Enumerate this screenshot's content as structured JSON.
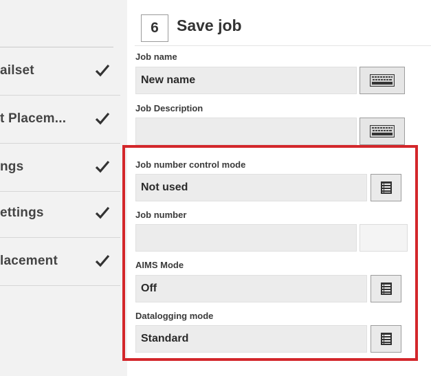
{
  "sidebar": {
    "items": [
      {
        "label": "ailset"
      },
      {
        "label": "t Placem..."
      },
      {
        "label": "ngs"
      },
      {
        "label": "ettings"
      },
      {
        "label": "lacement"
      }
    ]
  },
  "header": {
    "step_number": "6",
    "title": "Save job"
  },
  "form": {
    "job_name": {
      "label": "Job name",
      "value": "New name"
    },
    "job_description": {
      "label": "Job Description",
      "value": ""
    },
    "job_number_control_mode": {
      "label": "Job number control mode",
      "value": "Not used"
    },
    "job_number": {
      "label": "Job number",
      "value": ""
    },
    "aims_mode": {
      "label": "AIMS Mode",
      "value": "Off"
    },
    "datalogging_mode": {
      "label": "Datalogging mode",
      "value": "Standard"
    }
  },
  "colors": {
    "highlight": "#d3272b",
    "field_bg": "#ececec",
    "sidebar_bg": "#f2f2f2"
  },
  "icons": {
    "completed": "checkmark-icon",
    "keyboard": "keyboard-icon",
    "list": "list-icon"
  }
}
